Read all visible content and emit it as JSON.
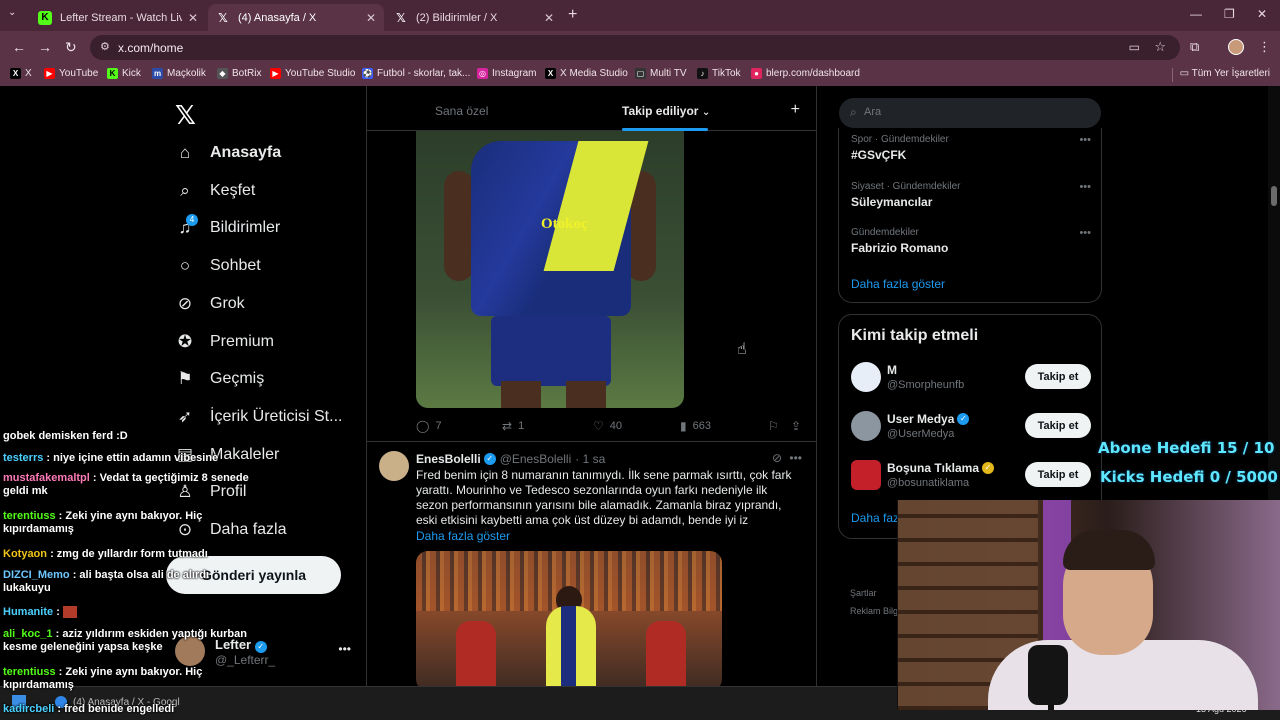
{
  "browser": {
    "tabs": [
      {
        "label": "Lefter Stream - Watch Live on K",
        "icon": "kick"
      },
      {
        "label": "(4) Anasayfa / X",
        "icon": "x"
      },
      {
        "label": "(2) Bildirimler / X",
        "icon": "x"
      }
    ],
    "url": "x.com/home",
    "bookmarks": [
      {
        "label": "X",
        "color": "#000000",
        "icon": "X"
      },
      {
        "label": "YouTube",
        "color": "#ff0000",
        "icon": "▶"
      },
      {
        "label": "Kick",
        "color": "#53fc18",
        "icon": "K"
      },
      {
        "label": "Maçkolik",
        "color": "#2c4aa8",
        "icon": "m"
      },
      {
        "label": "BotRix",
        "color": "#555555",
        "icon": "◆"
      },
      {
        "label": "YouTube Studio",
        "color": "#ff0000",
        "icon": "▶"
      },
      {
        "label": "Futbol - skorlar, tak...",
        "color": "#3b5cff",
        "icon": "⚽"
      },
      {
        "label": "Instagram",
        "color": "#d6249f",
        "icon": "◎"
      },
      {
        "label": "X Media Studio",
        "color": "#000000",
        "icon": "X"
      },
      {
        "label": "Multi TV",
        "color": "#333333",
        "icon": "▢"
      },
      {
        "label": "TikTok",
        "color": "#111111",
        "icon": "♪"
      },
      {
        "label": "blerp.com/dashboard",
        "color": "#e0245e",
        "icon": "●"
      }
    ],
    "all_bookmarks": "Tüm Yer İşaretleri"
  },
  "sidebar": {
    "items": [
      {
        "label": "Anasayfa",
        "icon": "home-icon"
      },
      {
        "label": "Keşfet",
        "icon": "search-icon"
      },
      {
        "label": "Bildirimler",
        "icon": "bell-icon"
      },
      {
        "label": "Sohbet",
        "icon": "chat-icon"
      },
      {
        "label": "Grok",
        "icon": "grok-icon"
      },
      {
        "label": "Premium",
        "icon": "premium-icon"
      },
      {
        "label": "Geçmiş",
        "icon": "bookmark-icon"
      },
      {
        "label": "İçerik Üreticisi St...",
        "icon": "rocket-icon"
      },
      {
        "label": "Makaleler",
        "icon": "article-icon"
      },
      {
        "label": "Profil",
        "icon": "profile-icon"
      },
      {
        "label": "Daha fazla",
        "icon": "more-icon"
      }
    ],
    "notif_count": "4",
    "post_button": "Gönderi yayınla",
    "user": {
      "name": "Lefter",
      "handle": "@_Lefterr_"
    }
  },
  "feed": {
    "tabs": [
      "Sana özel",
      "Takip ediliyor"
    ],
    "post1": {
      "sponsor": "Otokoç",
      "replies": "7",
      "reposts": "1",
      "likes": "40",
      "views": "663"
    },
    "post2": {
      "name": "EnesBolelli",
      "handle": "@EnesBolelli",
      "time": "· 1 sa",
      "text": "Fred benim için 8 numaranın tanımıydı. İlk sene parmak ısırttı, çok fark yarattı. Mourinho ve Tedesco sezonlarında oyun farkı nedeniyle ilk sezon performansının yarısını bile alamadık. Zamanla biraz yıprandı, eski etkisini kaybetti ama çok üst düzey bi adamdı, bende iyi iz",
      "show_more": "Daha fazla göster"
    }
  },
  "right": {
    "search_placeholder": "Ara",
    "trends": [
      {
        "context": "Spor · Gündemdekiler",
        "title": "#GSvÇFK"
      },
      {
        "context": "Siyaset · Gündemdekiler",
        "title": "Süleymancılar"
      },
      {
        "context": "Gündemdekiler",
        "title": "Fabrizio Romano"
      }
    ],
    "trends_more": "Daha fazla göster",
    "who_to_follow": {
      "title": "Kimi takip etmeli",
      "users": [
        {
          "name": "M",
          "handle": "@Smorpheunfb",
          "button": "Takip et",
          "verified": ""
        },
        {
          "name": "User Medya",
          "handle": "@UserMedya",
          "button": "Takip et",
          "verified": "blue"
        },
        {
          "name": "Boşuna Tıklama",
          "handle": "@bosunatiklama",
          "button": "Takip et",
          "verified": "gold"
        }
      ],
      "more": "Daha faz"
    },
    "footer": [
      "Şartlar",
      "Reklam Bilgi"
    ]
  },
  "stream": {
    "goals": [
      "Abone Hedefi 15 / 10",
      "Kicks Hedefi 0 / 5000"
    ],
    "chat": [
      {
        "user": "",
        "text": "gobek demisken ferd :D",
        "color": "#ffffff"
      },
      {
        "user": "testerrs",
        "text": ": niye içine ettin adamın vibesine",
        "color": "#4bd1ff"
      },
      {
        "user": "mustafakemaltpl",
        "text": ": Vedat ta geçtiğimiz 8 senede geldi mk",
        "color": "#ff7ab6"
      },
      {
        "user": "terentiuss",
        "text": ": Zeki yine aynı bakıyor. Hiç kıpırdamamış",
        "color": "#53fc18"
      },
      {
        "user": "Kotyaon",
        "text": ": zmg de yıllardır form tutmadı",
        "color": "#f0c419"
      },
      {
        "user": "DIZCI_Memo",
        "text": ": ali başta olsa ali de alırdı lukakuyu",
        "color": "#6ec6ff"
      },
      {
        "user": "Humanite",
        "text": ":",
        "color": "#4bd1ff"
      },
      {
        "user": "ali_koc_1",
        "text": ": aziz yıldırım eskiden yaptığı kurban kesme geleneğini yapsa keşke",
        "color": "#53fc18"
      },
      {
        "user": "terentiuss",
        "text": ": Zeki yine aynı bakıyor. Hiç kıpırdamamış",
        "color": "#53fc18"
      },
      {
        "user": "kadircbeli",
        "text": ": fred benide engelledi",
        "color": "#4bd1ff"
      }
    ]
  },
  "taskbar": {
    "title": "(4) Anasayfa / X - Googl",
    "date": "13 Ağu 2026"
  }
}
